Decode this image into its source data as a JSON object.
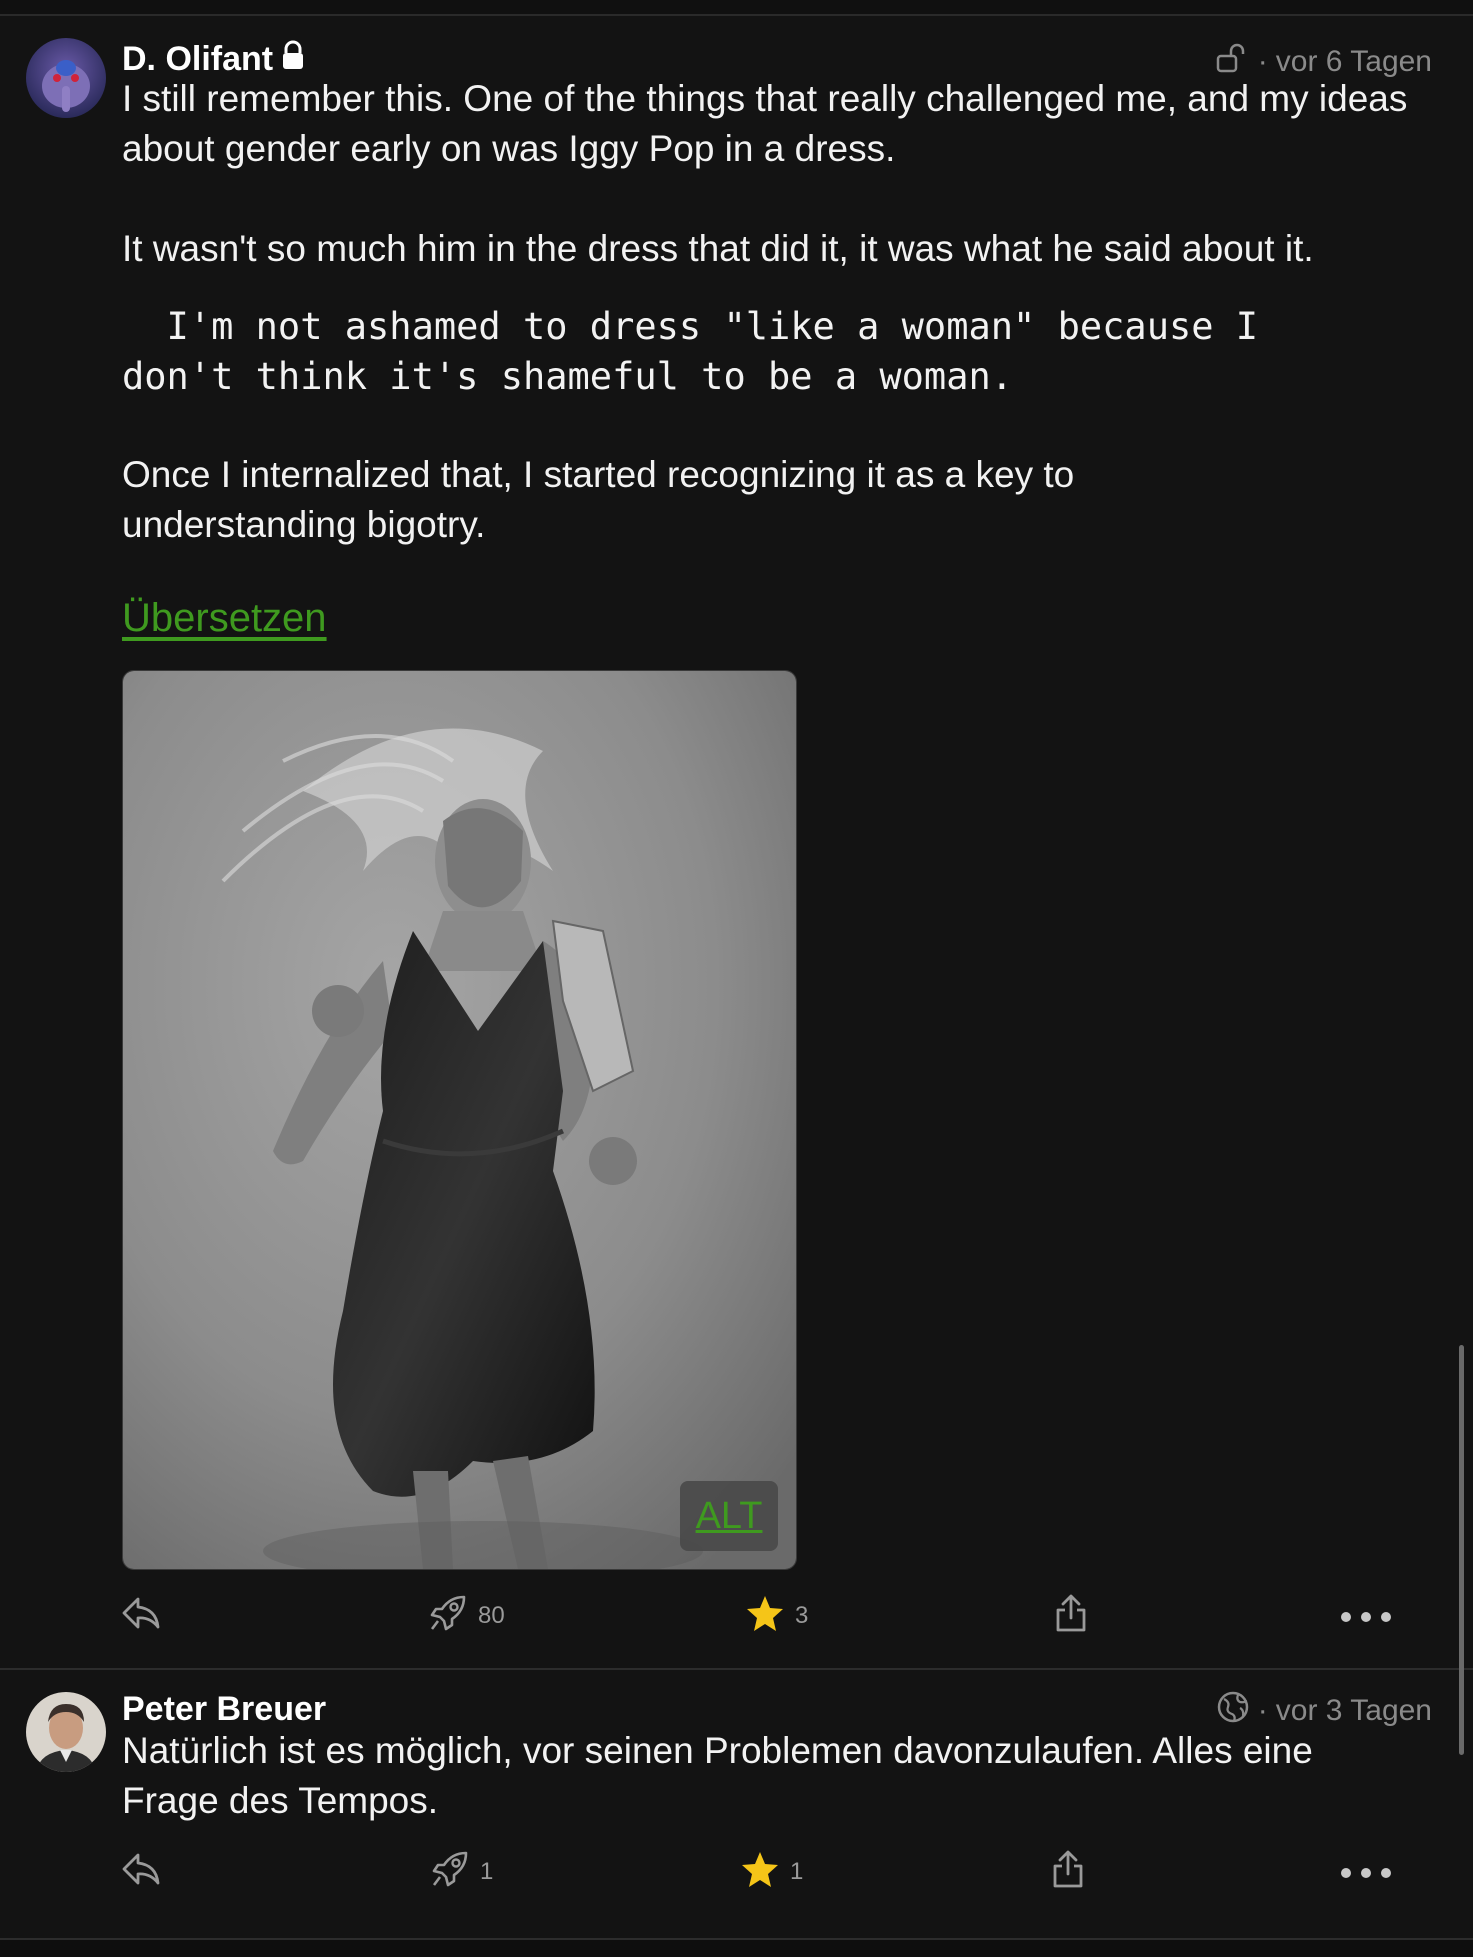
{
  "posts": [
    {
      "author": "D. Olifant",
      "time": "vor 6 Tagen",
      "visibility_icon": "unlock-icon",
      "author_badge_icon": "lock-icon",
      "paragraph1": "I still remember this. One of the things that really challenged me, and my ideas about gender early on was Iggy Pop in a dress.",
      "paragraph2": "It wasn't so much him in the dress that did it, it was what he said about it.",
      "quote_line1": "  I'm not ashamed to dress \"like a woman\" because I",
      "quote_line2": "don't think it's shameful to be a woman.",
      "paragraph3": "Once I internalized that, I started recognizing it as a key to understanding bigotry.",
      "translate_label": "Übersetzen",
      "media_alt_label": "ALT",
      "boost_count": "80",
      "favourite_count": "3"
    },
    {
      "author": "Peter Breuer",
      "time": "vor 3 Tagen",
      "visibility_icon": "globe-icon",
      "text": "Natürlich ist es möglich, vor seinen Problemen davonzulaufen. Alles eine Frage des Tempos.",
      "boost_count": "1",
      "favourite_count": "1"
    }
  ],
  "colors": {
    "background": "#131313",
    "link_green": "#3f9a1f",
    "star": "#f5c518",
    "muted": "#8a8a8a"
  }
}
